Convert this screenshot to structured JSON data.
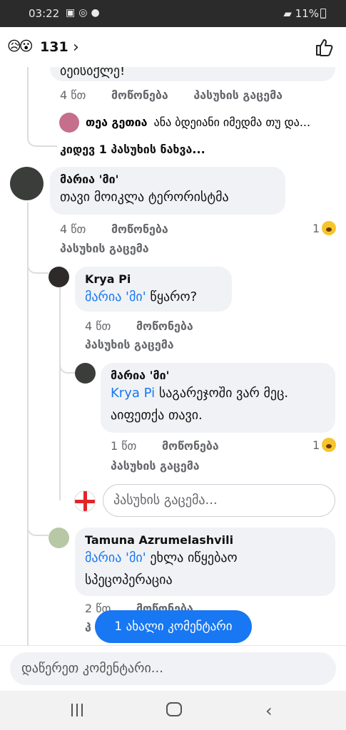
{
  "status_bar": {
    "time": "03:22",
    "battery": "11%"
  },
  "header": {
    "reaction_icons": [
      "sad-face-icon",
      "wow-face-icon"
    ],
    "reaction_count": "131"
  },
  "thread": {
    "partial_comment_text": "ბეისბქლე!",
    "partial_meta": {
      "time": "4 წთ",
      "like": "მოწონება",
      "reply": "პასუხის გაცემა"
    },
    "collapsed_reply": {
      "author": "თეა გეთია",
      "text": "ანა ბდეიანი იმედმა თუ და..."
    },
    "more_replies": "კიდევ 1 პასუხის ნახვა..."
  },
  "comments": [
    {
      "author": "მარია 'მი'",
      "text": "თავი მოიკლა ტერორისტმა",
      "time": "4 წთ",
      "like": "მოწონება",
      "reply": "პასუხის გაცემა",
      "reaction_count": "1"
    }
  ],
  "replies": [
    {
      "author": "Krya Pi",
      "mention": "მარია 'მი'",
      "text": "წყარო?",
      "time": "4 წთ",
      "like": "მოწონება",
      "reply": "პასუხის გაცემა"
    },
    {
      "author": "მარია 'მი'",
      "mention": "Krya Pi",
      "text_line1": "საგარეჯოში ვარ მეც.",
      "text_line2": "აიფეთქა თავი.",
      "time": "1 წთ",
      "like": "მოწონება",
      "reply": "პასუხის გაცემა",
      "reaction_count": "1"
    },
    {
      "author": "Tamuna Azrumelashvili",
      "mention": "მარია 'მი'",
      "text_line1": "ეხლა იწყებაო",
      "text_line2": "სპეცოპერაცია",
      "time": "2 წთ",
      "like": "მოწონება",
      "reply": "პ"
    }
  ],
  "reply_input_placeholder": "პასუხის გაცემა...",
  "new_comments_pill": "1 ახალი კომენტარი",
  "composer_placeholder": "დაწერეთ კომენტარი..."
}
